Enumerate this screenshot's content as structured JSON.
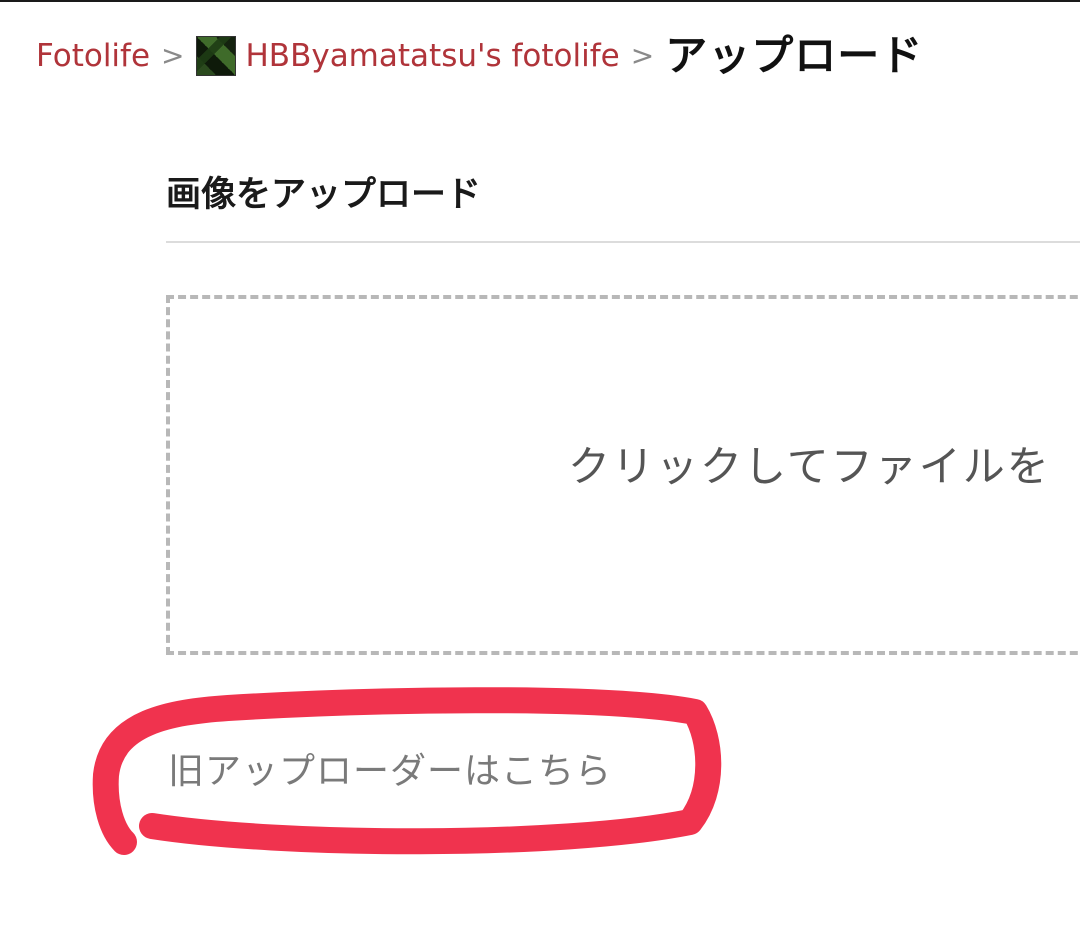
{
  "breadcrumb": {
    "root": "Fotolife",
    "separator": ">",
    "user": "HBByamatatsu's fotolife",
    "current": "アップロード"
  },
  "upload_section": {
    "title": "画像をアップロード",
    "dropzone_text": "クリックしてファイルを"
  },
  "old_uploader": {
    "link_text": "旧アップローダーはこちら"
  },
  "colors": {
    "link": "#b0343a",
    "annotation": "#f0334e",
    "dropzone_border": "#b8b8b8"
  }
}
